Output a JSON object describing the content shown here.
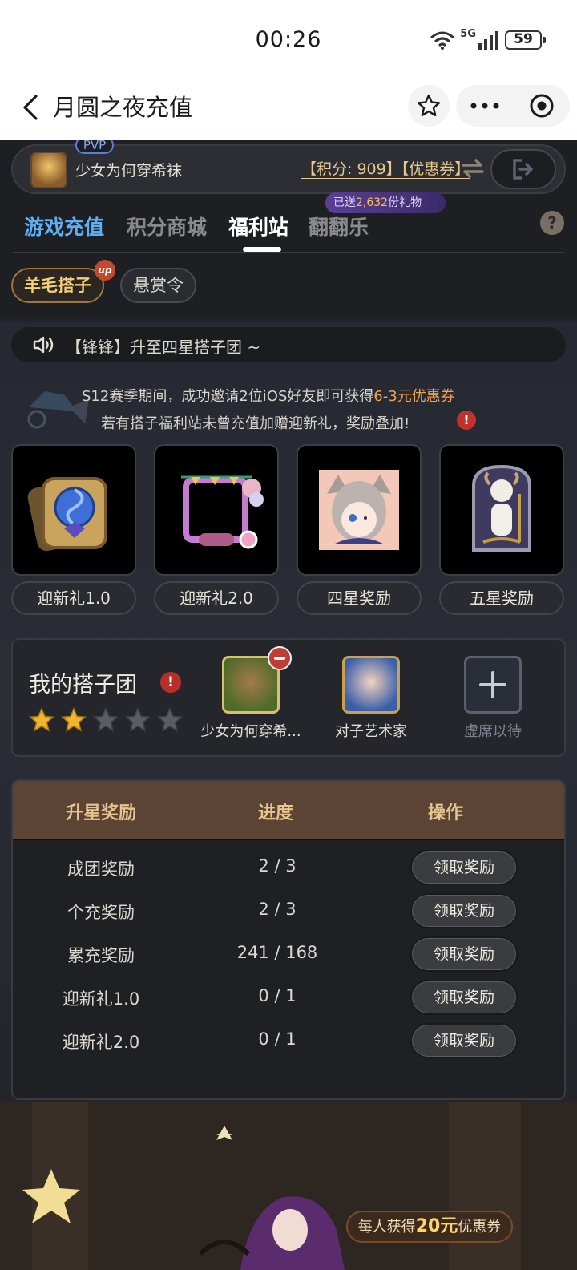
{
  "status_bar": {
    "time": "00:26",
    "network": "5G",
    "battery": "59"
  },
  "nav": {
    "title": "月圆之夜充值"
  },
  "profile": {
    "pvp_tag": "PVP",
    "name": "少女为何穿希袜",
    "points_label": "【积分: 909】",
    "coupon_label": "【优惠券】"
  },
  "tabs": [
    {
      "label": "游戏充值"
    },
    {
      "label": "积分商城"
    },
    {
      "label": "福利站"
    },
    {
      "label": "翻翻乐"
    }
  ],
  "gift_badge": {
    "prefix": "已送",
    "count": "2,632",
    "suffix": "份礼物"
  },
  "help": "?",
  "sub_tabs": [
    {
      "label": "羊毛搭子"
    },
    {
      "label": "悬赏令"
    }
  ],
  "up_badge": "up",
  "notice": "【锋锋】升至四星搭子团 ~",
  "info": {
    "line1_prefix": "S12赛季期间，成功邀请2位iOS好友即可获得",
    "line1_highlight": "6-3元优惠券",
    "line2": "若有搭子福利站未曾充值加赠迎新礼，奖励叠加!",
    "alert": "!"
  },
  "rewards": [
    {
      "label": "迎新礼1.0",
      "icon": "card-back-icon"
    },
    {
      "label": "迎新礼2.0",
      "icon": "avatar-frame-icon"
    },
    {
      "label": "四星奖励",
      "icon": "cat-girl-avatar-icon"
    },
    {
      "label": "五星奖励",
      "icon": "goat-character-icon"
    }
  ],
  "team": {
    "title": "我的搭子团",
    "alert": "!",
    "stars_filled": 2,
    "stars_total": 5,
    "members": [
      {
        "name": "少女为何穿希...",
        "color": "#4f6b2a"
      },
      {
        "name": "对子艺术家",
        "color": "#3a5fa8"
      },
      {
        "name": "虚席以待",
        "color": "#2a2e36"
      }
    ]
  },
  "table": {
    "headers": [
      "升星奖励",
      "进度",
      "操作"
    ],
    "rows": [
      {
        "name": "成团奖励",
        "progress": "2 / 3",
        "action": "领取奖励"
      },
      {
        "name": "个充奖励",
        "progress": "2 / 3",
        "action": "领取奖励"
      },
      {
        "name": "累充奖励",
        "progress": "241 / 168",
        "action": "领取奖励"
      },
      {
        "name": "迎新礼1.0",
        "progress": "0 / 1",
        "action": "领取奖励"
      },
      {
        "name": "迎新礼2.0",
        "progress": "0 / 1",
        "action": "领取奖励"
      }
    ]
  },
  "promo": {
    "prefix": "每人获得",
    "amount": "20元",
    "suffix": "优惠券"
  },
  "colors": {
    "accent_gold": "#e8c98a",
    "tab_blue": "#5fb0f2",
    "highlight_orange": "#f2a44a",
    "alert_red": "#c3312c"
  }
}
